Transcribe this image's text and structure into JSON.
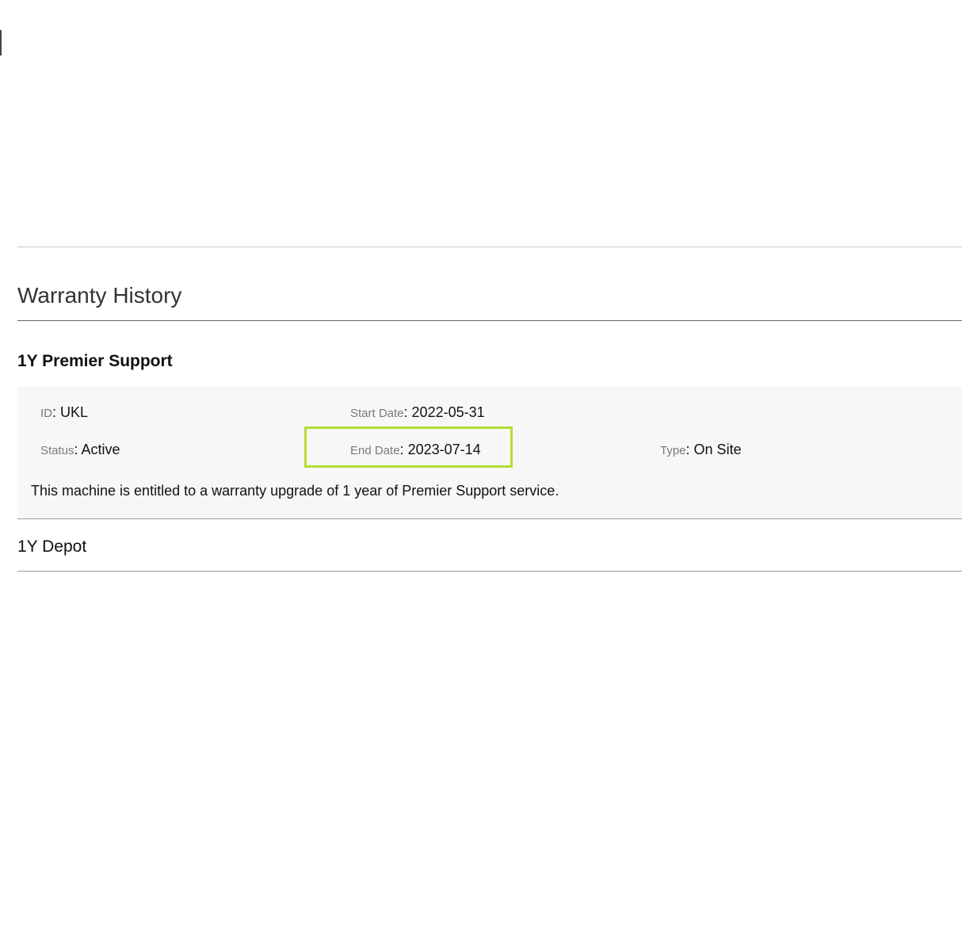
{
  "section": {
    "title": "Warranty History"
  },
  "warranties": [
    {
      "name": "1Y Premier Support",
      "expanded": true,
      "fields": {
        "id": {
          "label": "ID",
          "value": "UKL"
        },
        "start_date": {
          "label": "Start Date",
          "value": "2022-05-31"
        },
        "status": {
          "label": "Status",
          "value": "Active"
        },
        "end_date": {
          "label": "End Date",
          "value": "2023-07-14"
        },
        "type": {
          "label": "Type",
          "value": "On Site"
        }
      },
      "description": "This machine is entitled to a warranty upgrade of 1 year of Premier Support service."
    },
    {
      "name": "1Y Depot",
      "expanded": false
    }
  ],
  "colors": {
    "highlight": "#b5dc34",
    "panel_background": "#f7f7f7",
    "label_text": "#7a7a7a"
  }
}
